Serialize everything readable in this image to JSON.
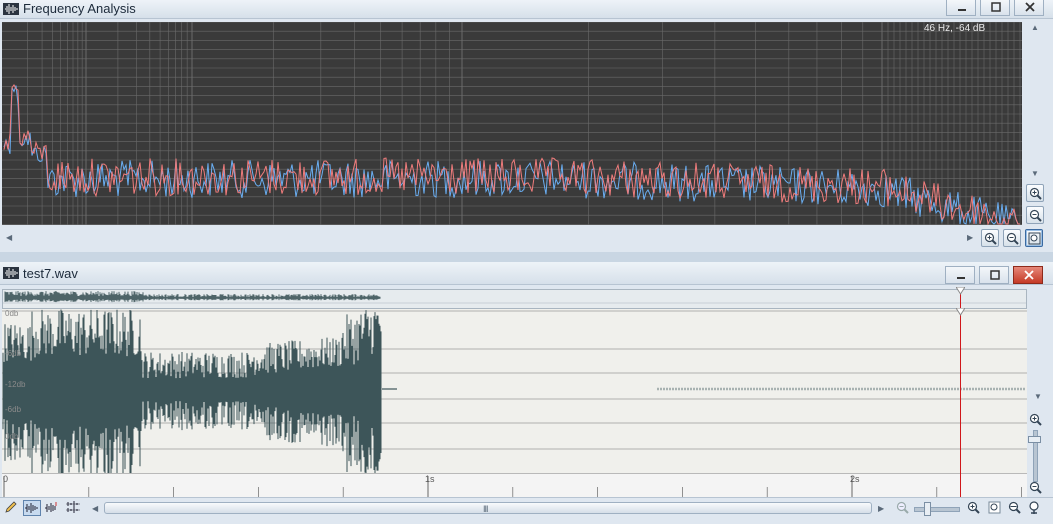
{
  "freq_window": {
    "title": "Frequency Analysis",
    "readout": "46 Hz, -64 dB",
    "colors": {
      "background": "#3a3a3a",
      "grid": "#6b6b6b",
      "channel_left": "#f07c7c",
      "channel_right": "#6aaef2"
    }
  },
  "wave_window": {
    "title": "test7.wav",
    "db_labels": [
      "0db",
      "-6db",
      "-12db",
      "-6db",
      "0db"
    ],
    "time_labels": [
      "0",
      "1s",
      "2s"
    ],
    "playhead_time_s": 2.26,
    "colors": {
      "waveform": "#3d5559",
      "playhead": "#d0181b"
    }
  },
  "toolbar": {
    "tools": [
      "pencil-icon",
      "waveform-view-icon",
      "spectral-view-icon",
      "stereo-view-icon"
    ],
    "scroll_grip": "III"
  }
}
